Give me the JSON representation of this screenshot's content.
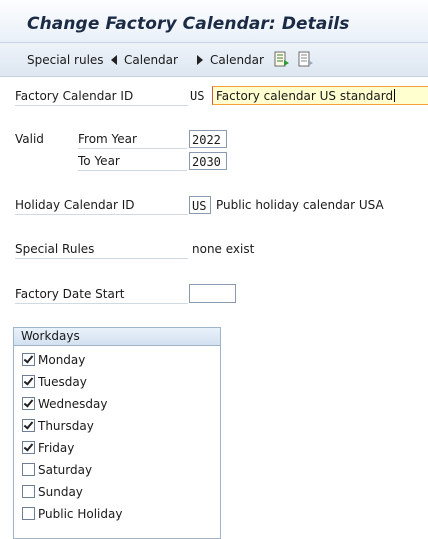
{
  "title": "Change Factory Calendar: Details",
  "toolbar": {
    "special_rules": "Special rules",
    "prev_calendar": "Calendar",
    "next_calendar": "Calendar"
  },
  "form": {
    "factory_calendar_id": {
      "label": "Factory Calendar ID",
      "code": "US",
      "description": "Factory calendar US standard"
    },
    "valid": {
      "label": "Valid",
      "from_label": "From Year",
      "from_value": "2022",
      "to_label": "To Year",
      "to_value": "2030"
    },
    "holiday_calendar_id": {
      "label": "Holiday Calendar ID",
      "code": "US",
      "description": "Public holiday calendar USA"
    },
    "special_rules": {
      "label": "Special Rules",
      "value": "none exist"
    },
    "factory_date_start": {
      "label": "Factory Date Start",
      "value": ""
    }
  },
  "workdays": {
    "title": "Workdays",
    "items": [
      {
        "label": "Monday",
        "checked": true
      },
      {
        "label": "Tuesday",
        "checked": true
      },
      {
        "label": "Wednesday",
        "checked": true
      },
      {
        "label": "Thursday",
        "checked": true
      },
      {
        "label": "Friday",
        "checked": true
      },
      {
        "label": "Saturday",
        "checked": false
      },
      {
        "label": "Sunday",
        "checked": false
      },
      {
        "label": "Public Holiday",
        "checked": false
      }
    ]
  },
  "colors": {
    "title_bar": "#e9f0f8",
    "input_highlight": "#ffffcf",
    "focus_border": "#f2a33a"
  }
}
